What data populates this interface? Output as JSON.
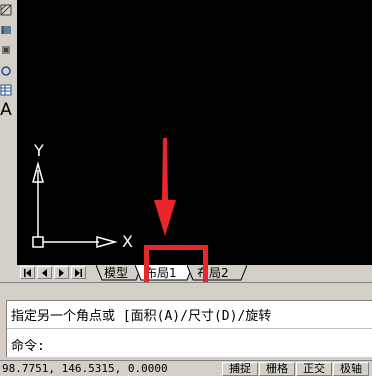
{
  "left_toolbar": {
    "tools": [
      "hatch-icon",
      "gradient-icon",
      "region-icon",
      "table-icon",
      "text-icon"
    ],
    "text_glyph": "A"
  },
  "canvas": {
    "background": "#000000",
    "ucs": {
      "y_label": "Y",
      "x_label": "X",
      "color": "#ffffff"
    }
  },
  "tabbar": {
    "nav_buttons": [
      "first-icon",
      "prev-icon",
      "next-icon",
      "last-icon"
    ],
    "tabs": [
      {
        "label": "模型",
        "active": false
      },
      {
        "label": "布局1",
        "active": true
      },
      {
        "label": "布局2",
        "active": false
      }
    ]
  },
  "annotation": {
    "highlight_color": "#e8262b",
    "target": "布局1"
  },
  "command": {
    "history": "指定另一个角点或 [面积(A)/尺寸(D)/旋转",
    "prompt": "命令:"
  },
  "statusbar": {
    "coords": "98.7751, 146.5315, 0.0000",
    "buttons": [
      "捕捉",
      "栅格",
      "正交",
      "极轴"
    ]
  }
}
